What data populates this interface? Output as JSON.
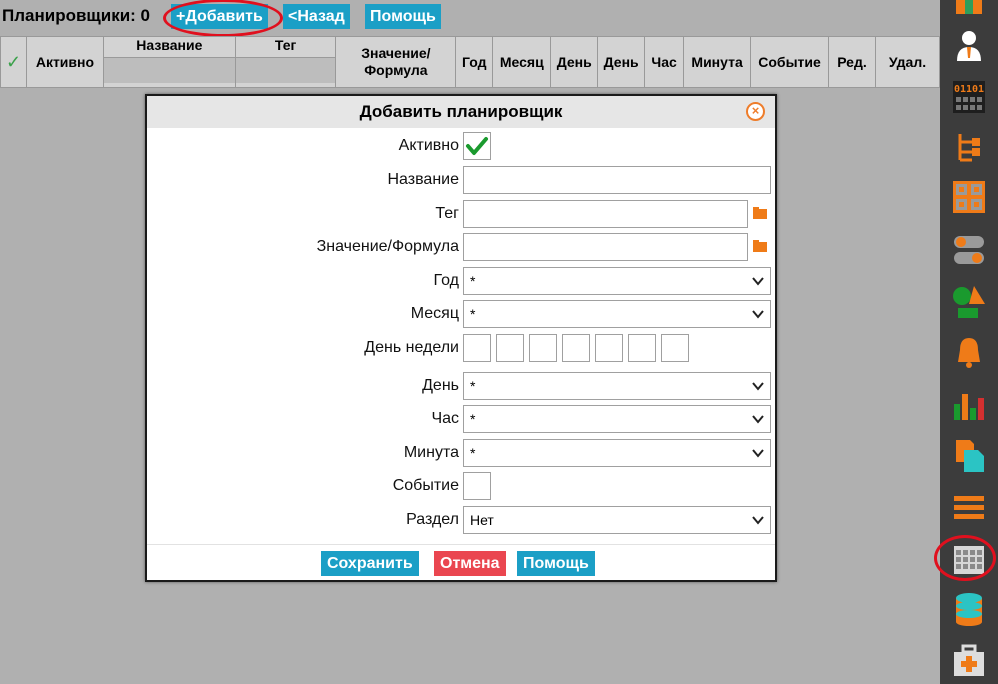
{
  "toolbar": {
    "title": "Планировщики: 0",
    "add_label": "+Добавить",
    "back_label": "<Назад",
    "help_label": "Помощь"
  },
  "grid": {
    "check_symbol": "✓",
    "columns": [
      "Активно",
      "Название",
      "Тег",
      "Значение/ Формула",
      "Год",
      "Месяц",
      "День",
      "День",
      "Час",
      "Минута",
      "Событие",
      "Ред.",
      "Удал."
    ]
  },
  "dialog": {
    "title": "Добавить планировщик",
    "fields": {
      "active": {
        "label": "Активно",
        "checked": true
      },
      "name": {
        "label": "Название",
        "value": ""
      },
      "tag": {
        "label": "Тег",
        "value": ""
      },
      "formula": {
        "label": "Значение/Формула",
        "value": ""
      },
      "year": {
        "label": "Год",
        "value": "*"
      },
      "month": {
        "label": "Месяц",
        "value": "*"
      },
      "weekday": {
        "label": "День недели",
        "boxes": 7
      },
      "day": {
        "label": "День",
        "value": "*"
      },
      "hour": {
        "label": "Час",
        "value": "*"
      },
      "minute": {
        "label": "Минута",
        "value": "*"
      },
      "event": {
        "label": "Событие",
        "checked": false
      },
      "section": {
        "label": "Раздел",
        "value": "Нет"
      }
    },
    "buttons": {
      "save": "Сохранить",
      "cancel": "Отмена",
      "help": "Помощь"
    }
  },
  "sidebar": {
    "icons": [
      "user-badge-icon",
      "operator-icon",
      "binary-display-icon",
      "tree-structure-icon",
      "grid-blocks-icon",
      "toggle-switches-icon",
      "shapes-icon",
      "alarm-bell-icon",
      "bar-chart-icon",
      "documents-icon",
      "menu-lines-icon",
      "scheduler-grid-icon",
      "database-icon",
      "first-aid-case-icon"
    ],
    "highlighted": "scheduler-grid-icon"
  },
  "colors": {
    "accent": "#1b9fc6",
    "danger": "#ea4650",
    "icon_orange": "#ef7b18",
    "sidebar_bg": "#3c3c3c",
    "highlight_ring": "#e0101e"
  }
}
